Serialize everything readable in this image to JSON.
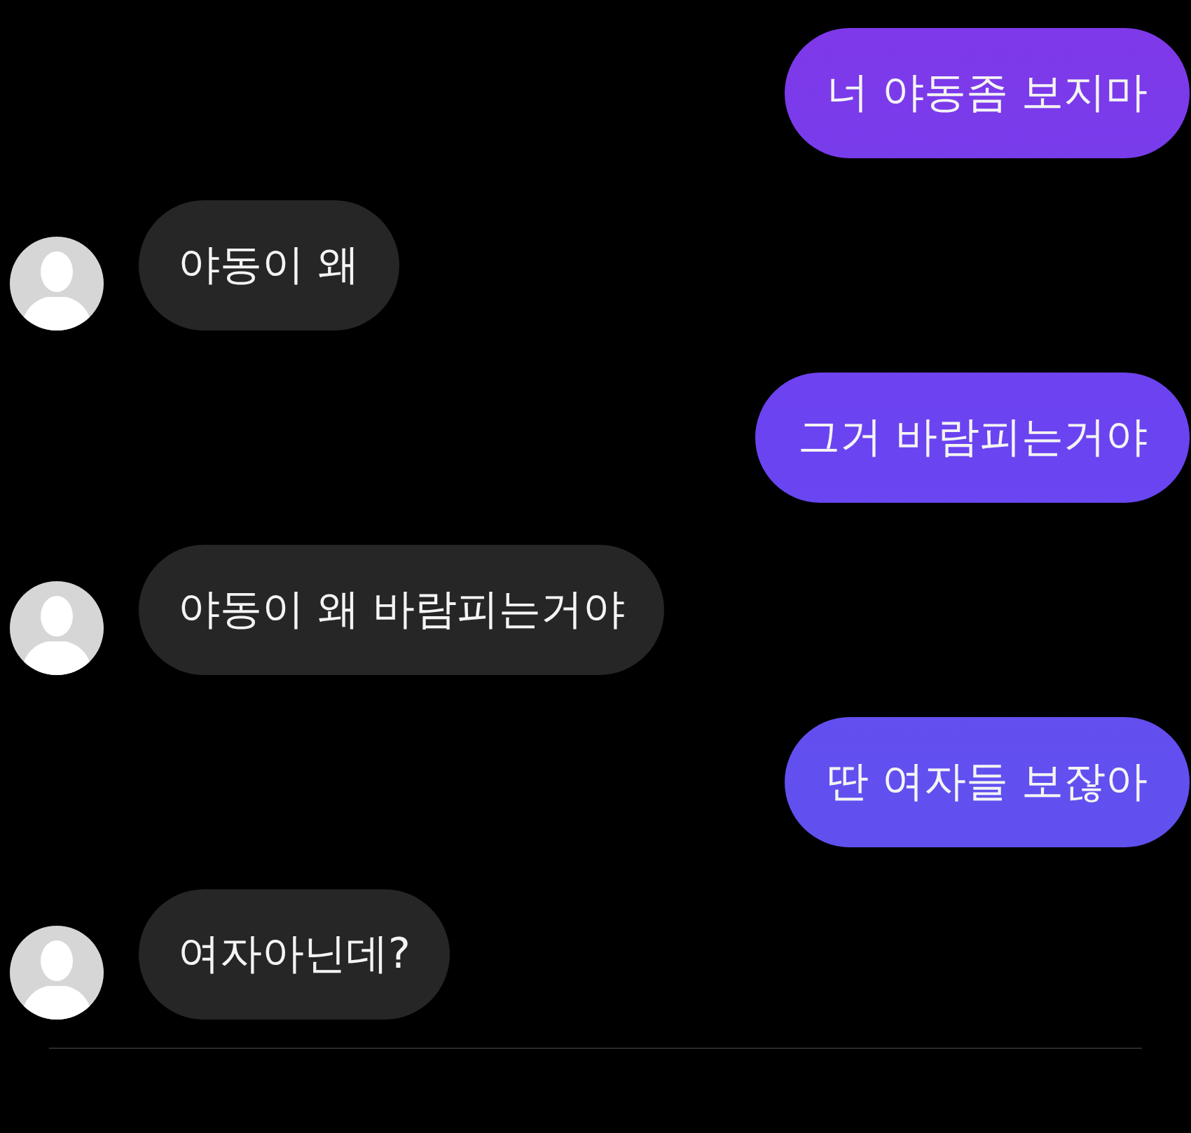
{
  "messages": [
    {
      "kind": "sent",
      "text": "너 야동좀 보지마"
    },
    {
      "kind": "received",
      "text": "야동이 왜"
    },
    {
      "kind": "sent",
      "text": "그거 바람피는거야"
    },
    {
      "kind": "received",
      "text": "야동이 왜 바람피는거야"
    },
    {
      "kind": "sent",
      "text": "딴 여자들 보잖아"
    },
    {
      "kind": "received",
      "text": "여자아닌데?"
    }
  ]
}
